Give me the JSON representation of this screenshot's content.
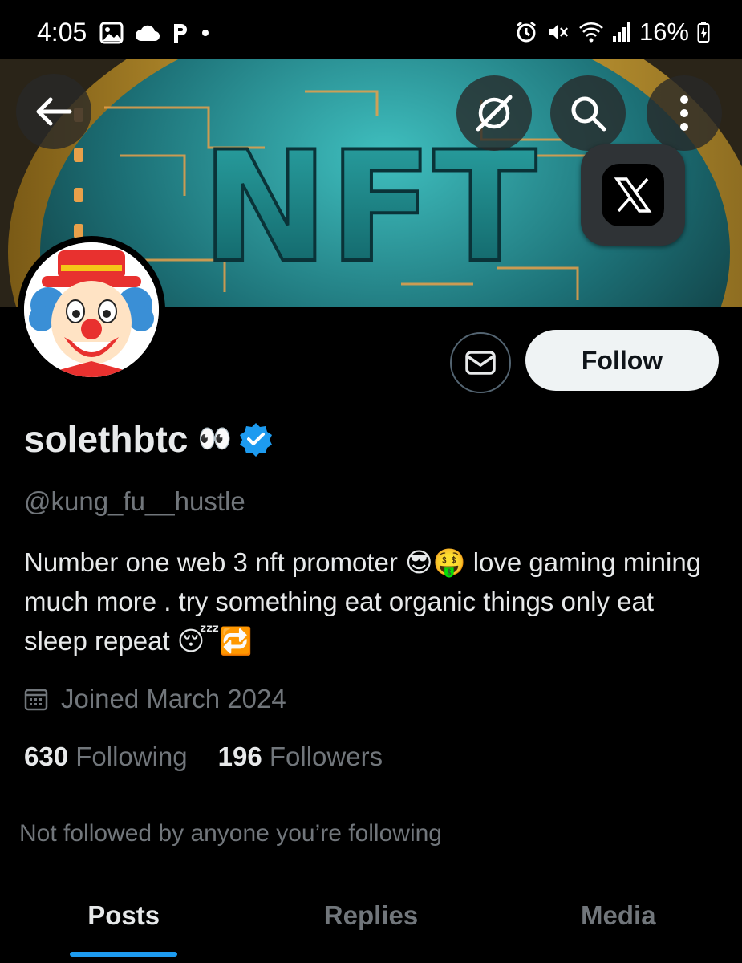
{
  "status_bar": {
    "time": "4:05",
    "battery": "16%",
    "left_icons": [
      "gallery-icon",
      "cloud-icon",
      "p-app-icon",
      "dot-icon"
    ],
    "right_icons": [
      "alarm-icon",
      "mute-icon",
      "wifi-icon",
      "signal-icon",
      "battery-icon"
    ]
  },
  "banner": {
    "text": "NFT"
  },
  "header_buttons": [
    "back-arrow-icon",
    "grok-icon",
    "search-icon",
    "more-vertical-icon"
  ],
  "profile": {
    "display_name": "solethbtc",
    "display_name_emoji": "👀",
    "verified": true,
    "handle": "@kung_fu__hustle",
    "bio": "Number one web 3 nft promoter 😎🤑  love gaming mining much more . try something  eat organic things only  eat sleep repeat 😴🔁",
    "joined": "Joined March 2024",
    "following_count": "630",
    "following_label": "Following",
    "followers_count": "196",
    "followers_label": "Followers",
    "not_followed": "Not followed by anyone you’re following"
  },
  "actions": {
    "follow_label": "Follow",
    "xapp_label": "X"
  },
  "tabs": [
    {
      "label": "Posts",
      "active": true
    },
    {
      "label": "Replies",
      "active": false
    },
    {
      "label": "Media",
      "active": false
    }
  ],
  "colors": {
    "accent": "#1d9bf0",
    "background": "#000000",
    "secondary_text": "#71767b"
  }
}
